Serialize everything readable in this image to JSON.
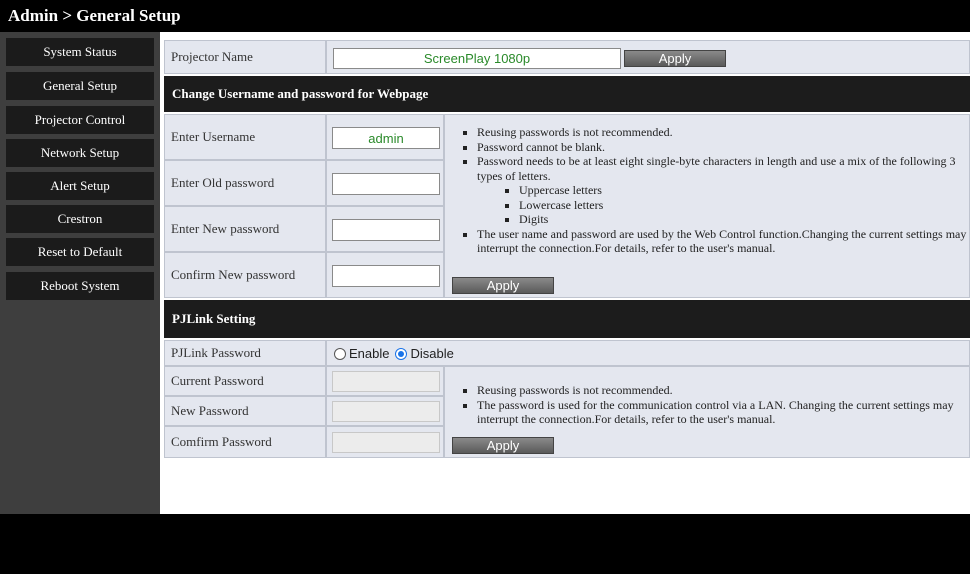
{
  "header": {
    "title": "Admin > General Setup"
  },
  "sidebar": {
    "items": [
      {
        "label": "System Status"
      },
      {
        "label": "General Setup"
      },
      {
        "label": "Projector Control"
      },
      {
        "label": "Network Setup"
      },
      {
        "label": "Alert Setup"
      },
      {
        "label": "Crestron"
      },
      {
        "label": "Reset to Default"
      },
      {
        "label": "Reboot System"
      }
    ]
  },
  "projector_name": {
    "label": "Projector Name",
    "value": "ScreenPlay 1080p",
    "apply_label": "Apply"
  },
  "webpage_credentials": {
    "section_title": "Change Username and password for Webpage",
    "username_label": "Enter Username",
    "username_value": "admin",
    "old_password_label": "Enter Old password",
    "new_password_label": "Enter New password",
    "confirm_password_label": "Confirm New password",
    "notes": [
      "Reusing passwords is not recommended.",
      "Password cannot be blank.",
      "Password needs to be at least eight single-byte characters in length and use a mix of the following 3 types of letters.",
      "The user name and password are used by the Web Control function.Changing the current settings may interrupt the connection.For details, refer to the user's manual."
    ],
    "sub_notes": [
      "Uppercase letters",
      "Lowercase letters",
      "Digits"
    ],
    "apply_label": "Apply"
  },
  "pjlink": {
    "section_title": "PJLink Setting",
    "password_label": "PJLink Password",
    "enable_label": "Enable",
    "disable_label": "Disable",
    "selected": "Disable",
    "current_password_label": "Current Password",
    "new_password_label": "New Password",
    "confirm_password_label": "Comfirm Password",
    "notes": [
      "Reusing passwords is not recommended.",
      "The password is used for the communication control via a LAN. Changing the current settings may interrupt the connection.For details, refer to the user's manual."
    ],
    "apply_label": "Apply"
  }
}
